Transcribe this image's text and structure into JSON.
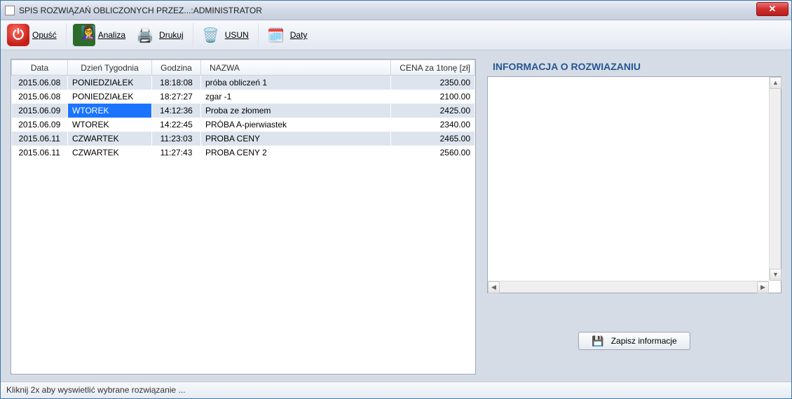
{
  "window": {
    "title": "SPIS ROZWIĄZAŃ OBLICZONYCH PRZEZ...:ADMINISTRATOR"
  },
  "toolbar": {
    "opusc": "Opuść",
    "analiza": "Analiza",
    "drukuj": "Drukuj",
    "usun": "USUN",
    "daty": "Daty"
  },
  "grid": {
    "columns": {
      "data": "Data",
      "dzien": "Dzień Tygodnia",
      "godzina": "Godzina",
      "nazwa": "NAZWA",
      "cena": "CENA za 1tonę [zł]"
    },
    "rows": [
      {
        "data": "2015.06.08",
        "dzien": "PONIEDZIAŁEK",
        "godzina": "18:18:08",
        "nazwa": "próba obliczeń 1",
        "cena": "2350.00",
        "striped": true,
        "selected": false
      },
      {
        "data": "2015.06.08",
        "dzien": "PONIEDZIAŁEK",
        "godzina": "18:27:27",
        "nazwa": "zgar -1",
        "cena": "2100.00",
        "striped": false,
        "selected": false
      },
      {
        "data": "2015.06.09",
        "dzien": "WTOREK",
        "godzina": "14:12:36",
        "nazwa": " Proba ze złomem",
        "cena": "2425.00",
        "striped": true,
        "selected": true
      },
      {
        "data": "2015.06.09",
        "dzien": "WTOREK",
        "godzina": "14:22:45",
        "nazwa": "PRÓBA  A-pierwiastek",
        "cena": "2340.00",
        "striped": false,
        "selected": false
      },
      {
        "data": "2015.06.11",
        "dzien": "CZWARTEK",
        "godzina": "11:23:03",
        "nazwa": "PROBA CENY",
        "cena": "2465.00",
        "striped": true,
        "selected": false
      },
      {
        "data": "2015.06.11",
        "dzien": "CZWARTEK",
        "godzina": "11:27:43",
        "nazwa": "PROBA CENY 2",
        "cena": "2560.00",
        "striped": false,
        "selected": false
      }
    ]
  },
  "info": {
    "title": "INFORMACJA O ROZWIAZANIU",
    "content": ""
  },
  "buttons": {
    "save_info": "Zapisz informacje"
  },
  "status": {
    "text": "Kliknij 2x aby wyswietlić wybrane rozwiązanie ..."
  }
}
